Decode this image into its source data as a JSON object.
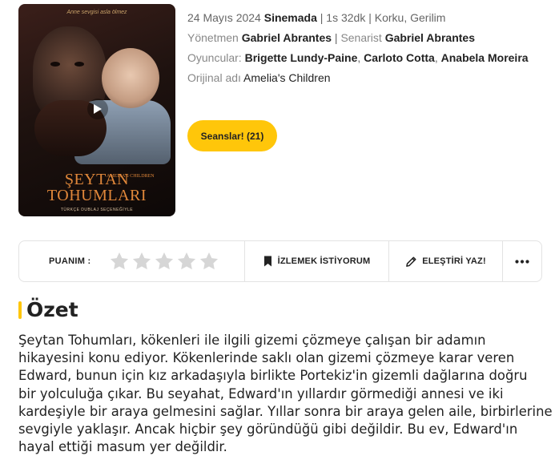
{
  "poster": {
    "tagline": "Anne sevgisi asla ölmez",
    "title_line1": "ŞEYTAN",
    "title_line2": "TOHUMLARI",
    "subtitle": "AMELIA'S CHILDREN",
    "dub_note": "TÜRKÇE DUBLAJ SEÇENEĞİYLE"
  },
  "meta": {
    "date": "24 Mayıs 2024",
    "status": "Sinemada",
    "duration": "1s 32dk",
    "genres": "Korku, Gerilim",
    "director_label": "Yönetmen",
    "director": "Gabriel Abrantes",
    "writer_label": "Senarist",
    "writer": "Gabriel Abrantes",
    "cast_label": "Oyuncular:",
    "cast": [
      "Brigette Lundy-Paine",
      "Carloto Cotta",
      "Anabela Moreira"
    ],
    "original_label": "Orijinal adı",
    "original_title": "Amelia's Children"
  },
  "buttons": {
    "seans": "Seanslar! (21)",
    "watchlist": "İZLEMEK İSTİYORUM",
    "review": "ELEŞTİRİ YAZ!"
  },
  "rating": {
    "label": "PUANIM :",
    "stars_total": 5,
    "stars_filled": 0
  },
  "summary": {
    "title": "Özet",
    "lines": [
      "Şeytan Tohumları, kökenleri ile ilgili gizemi çözmeye çalışan bir adamın",
      "hikayesini konu ediyor. Kökenlerinde saklı olan gizemi çözmeye karar veren",
      "Edward, bunun için kız arkadaşıyla birlikte Portekiz'in gizemli dağlarına doğru",
      "bir yolculuğa çıkar. Bu seyahat, Edward'ın yıllardır görmediği annesi ve iki",
      "kardeşiyle bir araya gelmesini sağlar. Yıllar sonra bir araya gelen aile, birbirlerine",
      "sevgiyle yaklaşır. Ancak hiçbir şey göründüğü gibi değildir. Bu ev, Edward'ın",
      "hayal ettiği masum yer değildir."
    ]
  },
  "colors": {
    "accent": "#ffc60a",
    "star_empty": "#d6d6d6"
  },
  "icons": {
    "play": "play-icon",
    "bookmark": "bookmark-icon",
    "pencil": "pencil-icon",
    "more": "more-dots-icon",
    "star": "star-icon"
  }
}
